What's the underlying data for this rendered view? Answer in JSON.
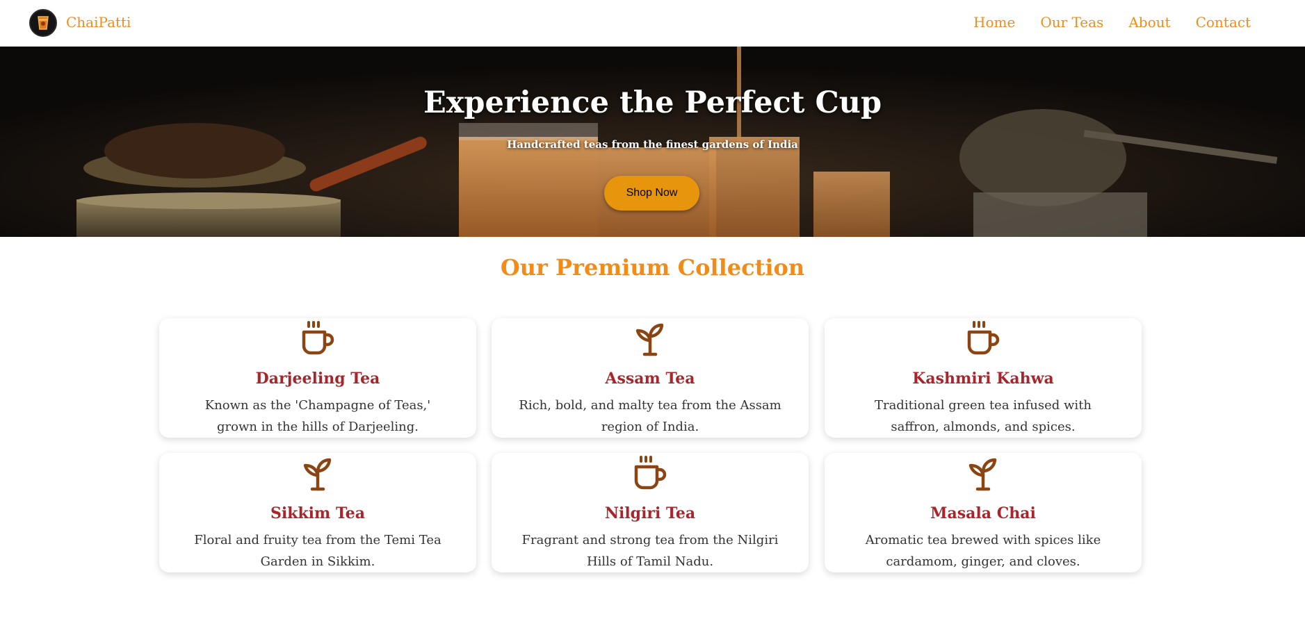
{
  "nav": {
    "brand": "ChaiPatti",
    "links": [
      "Home",
      "Our Teas",
      "About",
      "Contact"
    ]
  },
  "hero": {
    "title": "Experience the Perfect Cup",
    "subtitle": "Handcrafted teas from the finest gardens of India",
    "button": "Shop Now"
  },
  "collection": {
    "title": "Our Premium Collection",
    "cards": [
      {
        "icon": "coffee-cup-icon",
        "title": "Darjeeling Tea",
        "desc": "Known as the 'Champagne of Teas,' grown in the hills of Darjeeling."
      },
      {
        "icon": "sprout-icon",
        "title": "Assam Tea",
        "desc": "Rich, bold, and malty tea from the Assam region of India."
      },
      {
        "icon": "coffee-cup-icon",
        "title": "Kashmiri Kahwa",
        "desc": "Traditional green tea infused with saffron, almonds, and spices."
      },
      {
        "icon": "sprout-icon",
        "title": "Sikkim Tea",
        "desc": "Floral and fruity tea from the Temi Tea Garden in Sikkim."
      },
      {
        "icon": "coffee-cup-icon",
        "title": "Nilgiri Tea",
        "desc": "Fragrant and strong tea from the Nilgiri Hills of Tamil Nadu."
      },
      {
        "icon": "sprout-icon",
        "title": "Masala Chai",
        "desc": "Aromatic tea brewed with spices like cardamom, ginger, and cloves."
      }
    ]
  },
  "colors": {
    "accent": "#f28c18",
    "button": "#e8950e",
    "card_title": "#a8262b",
    "icon": "#8b4513"
  }
}
